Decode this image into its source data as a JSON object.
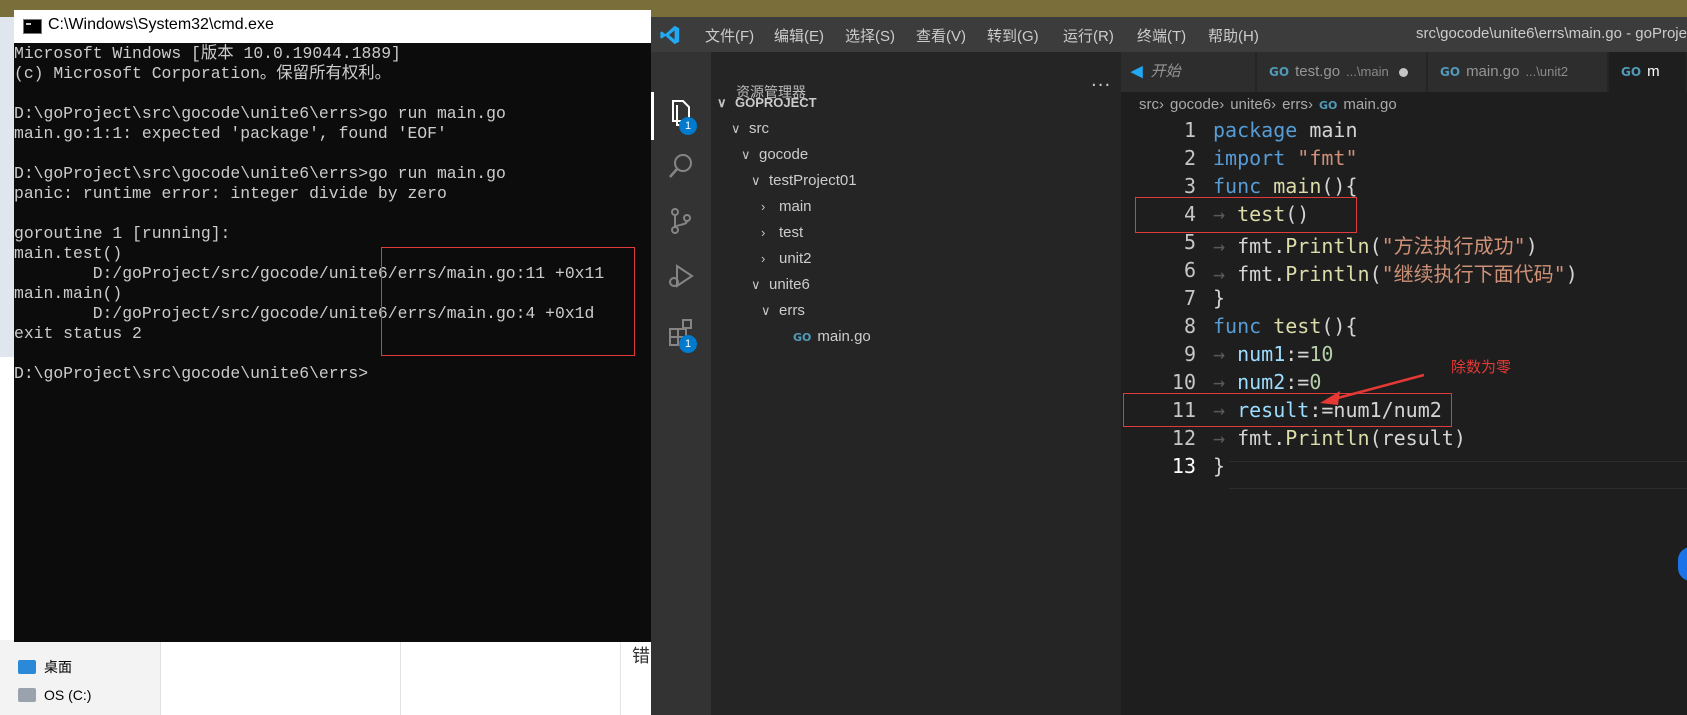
{
  "explorer": {
    "nav_items": [
      {
        "label": "桌面"
      },
      {
        "label": "OS (C:)"
      }
    ],
    "partial_glyph": "错"
  },
  "cmd": {
    "title": "C:\\Windows\\System32\\cmd.exe",
    "output": "Microsoft Windows [版本 10.0.19044.1889]\n(c) Microsoft Corporation。保留所有权利。\n\nD:\\goProject\\src\\gocode\\unite6\\errs>go run main.go\nmain.go:1:1: expected 'package', found 'EOF'\n\nD:\\goProject\\src\\gocode\\unite6\\errs>go run main.go\npanic: runtime error: integer divide by zero\n\ngoroutine 1 [running]:\nmain.test()\n        D:/goProject/src/gocode/unite6/errs/main.go:11 +0x11\nmain.main()\n        D:/goProject/src/gocode/unite6/errs/main.go:4 +0x1d\nexit status 2\n\nD:\\goProject\\src\\gocode\\unite6\\errs>"
  },
  "vscode": {
    "menu": [
      "文件(F)",
      "编辑(E)",
      "选择(S)",
      "查看(V)",
      "转到(G)",
      "运行(R)",
      "终端(T)",
      "帮助(H)"
    ],
    "window_title": "src\\gocode\\unite6\\errs\\main.go - goProje",
    "activity_badges": {
      "explorer": "1",
      "extensions": "1"
    },
    "sidebar": {
      "title": "资源管理器",
      "more": "···",
      "root": "GOPROJECT",
      "tree": [
        {
          "label": "src",
          "level": 1,
          "chev": "∨"
        },
        {
          "label": "gocode",
          "level": 2,
          "chev": "∨"
        },
        {
          "label": "testProject01",
          "level": 3,
          "chev": "∨"
        },
        {
          "label": "main",
          "level": 4,
          "chev": "›"
        },
        {
          "label": "test",
          "level": 4,
          "chev": "›"
        },
        {
          "label": "unit2",
          "level": 4,
          "chev": "›"
        },
        {
          "label": "unite6",
          "level": 3,
          "chev": "∨"
        },
        {
          "label": "errs",
          "level": 4,
          "chev": "∨"
        },
        {
          "label": "main.go",
          "level": 5,
          "chev": "",
          "icon": "GO"
        }
      ]
    },
    "tabs": [
      {
        "label": "开始",
        "desc": ""
      },
      {
        "label": "test.go",
        "desc": "...\\main"
      },
      {
        "label": "main.go",
        "desc": "...\\unit2"
      },
      {
        "label": "m",
        "desc": ""
      }
    ],
    "breadcrumb": [
      "src",
      "gocode",
      "unite6",
      "errs",
      "main.go"
    ],
    "line_numbers": [
      "1",
      "2",
      "3",
      "4",
      "5",
      "6",
      "7",
      "8",
      "9",
      "10",
      "11",
      "12",
      "13"
    ],
    "annotation": "除数为零",
    "colors": {
      "accent": "#007acc",
      "highlight": "#e03a3a"
    }
  }
}
